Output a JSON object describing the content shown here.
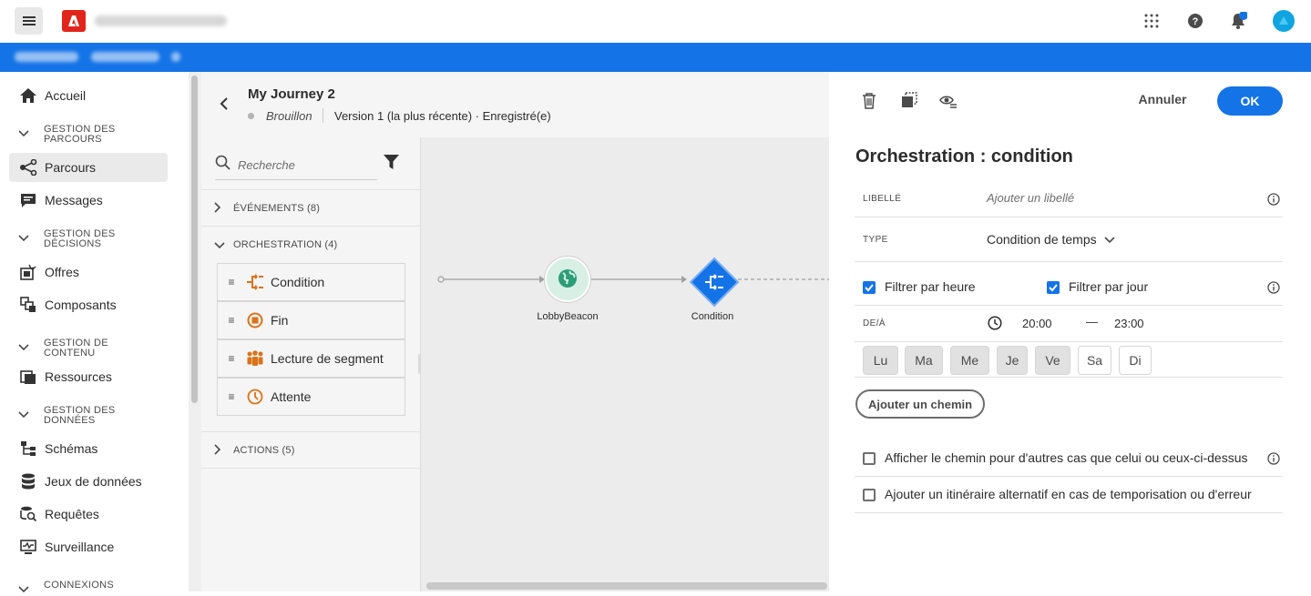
{
  "topbar": {
    "icons": [
      "apps-icon",
      "help-icon",
      "bell-icon",
      "avatar"
    ]
  },
  "sidebar": {
    "items": [
      {
        "type": "item",
        "label": "Accueil",
        "icon": "home-icon"
      },
      {
        "type": "section",
        "label": "GESTION DES PARCOURS"
      },
      {
        "type": "item",
        "label": "Parcours",
        "icon": "journey-icon",
        "active": true
      },
      {
        "type": "item",
        "label": "Messages",
        "icon": "message-icon"
      },
      {
        "type": "section",
        "label": "GESTION DES DÉCISIONS"
      },
      {
        "type": "item",
        "label": "Offres",
        "icon": "offers-icon"
      },
      {
        "type": "item",
        "label": "Composants",
        "icon": "components-icon"
      },
      {
        "type": "section",
        "label": "GESTION DE CONTENU"
      },
      {
        "type": "item",
        "label": "Ressources",
        "icon": "assets-icon"
      },
      {
        "type": "section",
        "label": "GESTION DES DONNÉES"
      },
      {
        "type": "item",
        "label": "Schémas",
        "icon": "schema-icon"
      },
      {
        "type": "item",
        "label": "Jeux de données",
        "icon": "dataset-icon"
      },
      {
        "type": "item",
        "label": "Requêtes",
        "icon": "queries-icon"
      },
      {
        "type": "item",
        "label": "Surveillance",
        "icon": "monitoring-icon"
      },
      {
        "type": "section",
        "label": "CONNEXIONS"
      }
    ]
  },
  "journey": {
    "title": "My Journey 2",
    "status": "Brouillon",
    "version": "Version 1 (la plus récente) · Enregistré(e)"
  },
  "palette": {
    "search_placeholder": "Recherche",
    "categories": {
      "events": "ÉVÉNEMENTS (8)",
      "orchestration": "ORCHESTRATION (4)",
      "actions": "ACTIONS (5)"
    },
    "orchestration_items": [
      {
        "label": "Condition",
        "icon": "condition-icon"
      },
      {
        "label": "Fin",
        "icon": "end-icon"
      },
      {
        "label": "Lecture de segment",
        "icon": "segment-icon"
      },
      {
        "label": "Attente",
        "icon": "wait-icon"
      }
    ]
  },
  "canvas": {
    "nodes": [
      {
        "label": "LobbyBeacon",
        "icon": "globe-icon"
      },
      {
        "label": "Condition",
        "icon": "condition-icon"
      }
    ]
  },
  "panel": {
    "cancel": "Annuler",
    "ok": "OK",
    "title": "Orchestration : condition",
    "label_field": {
      "label": "LIBELLÉ",
      "placeholder": "Ajouter un libellé"
    },
    "type_field": {
      "label": "TYPE",
      "value": "Condition de temps"
    },
    "filter_hour": {
      "label": "Filtrer par heure",
      "checked": true
    },
    "filter_day": {
      "label": "Filtrer par jour",
      "checked": true
    },
    "from_to": {
      "label": "DE/À",
      "from": "20:00",
      "separator": "—",
      "to": "23:00"
    },
    "days": [
      {
        "label": "Lu",
        "selected": true
      },
      {
        "label": "Ma",
        "selected": true
      },
      {
        "label": "Me",
        "selected": true
      },
      {
        "label": "Je",
        "selected": true
      },
      {
        "label": "Ve",
        "selected": true
      },
      {
        "label": "Sa",
        "selected": false
      },
      {
        "label": "Di",
        "selected": false
      }
    ],
    "add_path": "Ajouter un chemin",
    "other_cases": {
      "label": "Afficher le chemin pour d'autres cas que celui ou ceux-ci-dessus",
      "checked": false
    },
    "alt_route": {
      "label": "Ajouter un itinéraire alternatif en cas de temporisation ou d'erreur",
      "checked": false
    }
  },
  "colors": {
    "accent": "#1473e6",
    "adobe_red": "#e1251b",
    "orchestration_orange": "#d9741a",
    "beacon_green": "#2d9d78"
  }
}
